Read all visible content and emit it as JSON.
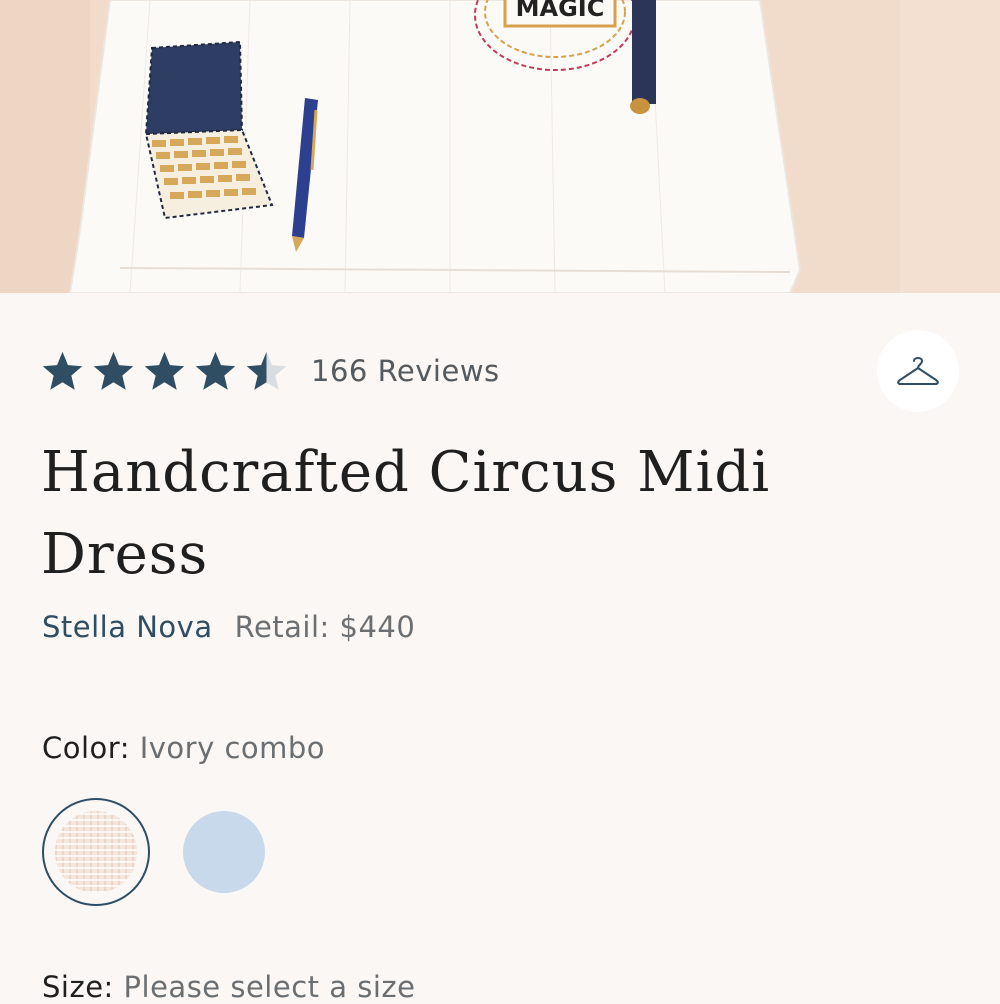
{
  "hero": {
    "embroidery_text": "MAGIC"
  },
  "rating": {
    "value": 4.5,
    "max": 5,
    "reviews_label": "166 Reviews"
  },
  "product": {
    "title": "Handcrafted Circus Midi Dress",
    "brand": "Stella Nova",
    "retail": "Retail: $440"
  },
  "color": {
    "label": "Color:",
    "selected": "Ivory combo",
    "swatches": [
      {
        "name": "Ivory combo",
        "hex": "#f4e6dc",
        "selected": true
      },
      {
        "name": "Light blue",
        "hex": "#c8d9ec",
        "selected": false
      }
    ]
  },
  "size": {
    "label": "Size:",
    "placeholder": "Please select a size"
  },
  "colors": {
    "accent": "#2f4d63",
    "star": "#2f4d63",
    "background": "#faf7f4"
  },
  "icons": {
    "save": "hanger-icon"
  }
}
